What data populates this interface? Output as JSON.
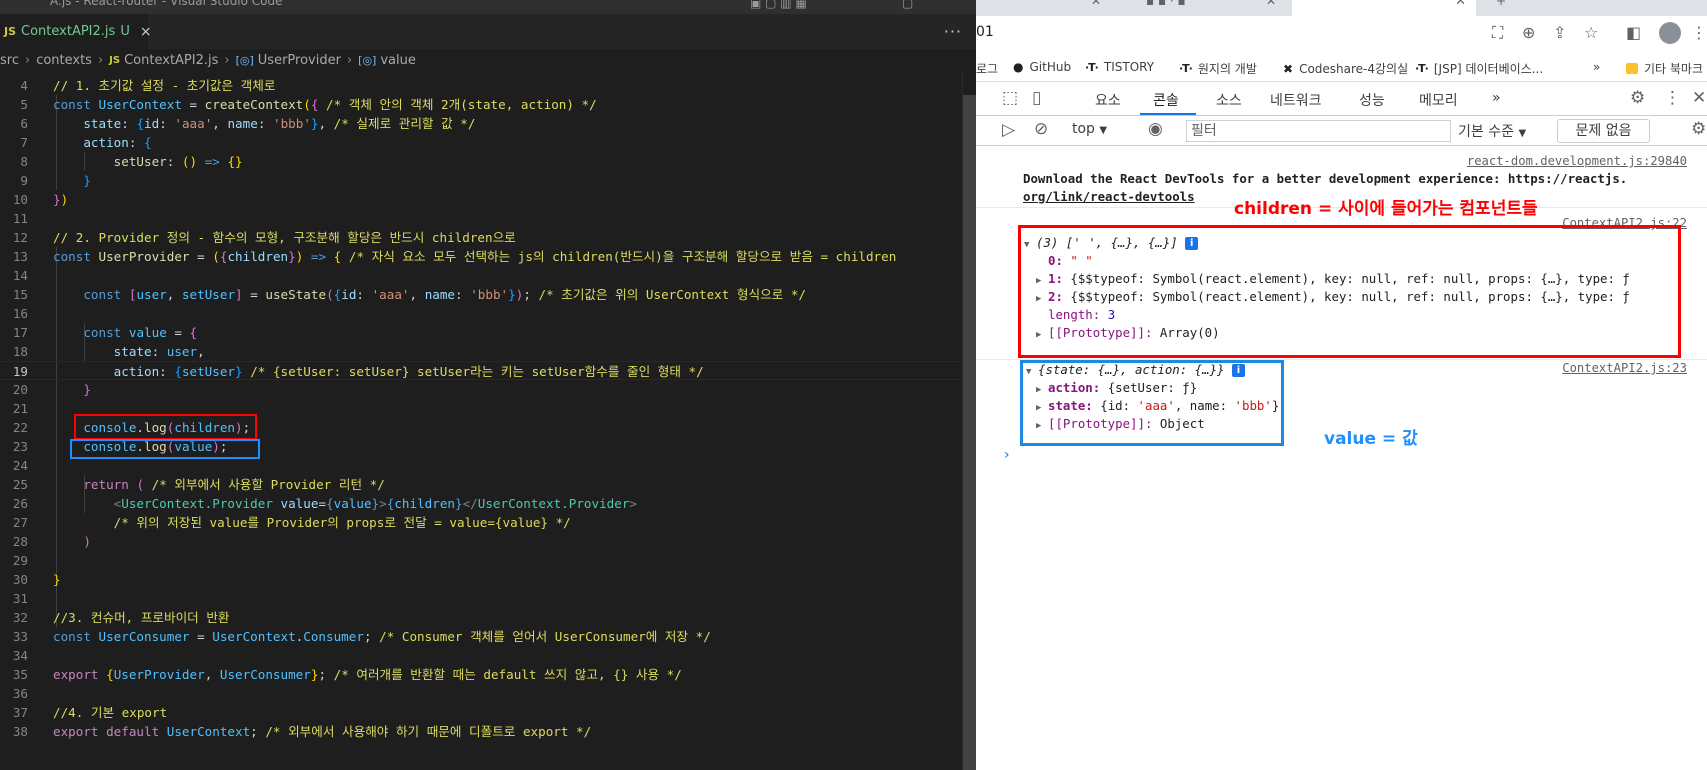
{
  "vscode": {
    "window_title": "A.js - React-router - Visual Studio Code",
    "tab": {
      "icon": "JS",
      "filename": "ContextAPI2.js",
      "status": "U",
      "close": "×"
    },
    "more_actions": "···",
    "breadcrumb": {
      "items": [
        "src",
        "contexts",
        "ContextAPI2.js",
        "UserProvider",
        "value"
      ],
      "js_icon": "JS",
      "symbol_icon": "[◎]"
    },
    "editor": {
      "line_numbers": [
        "4",
        "5",
        "6",
        "7",
        "8",
        "9",
        "10",
        "11",
        "12",
        "13",
        "14",
        "15",
        "16",
        "17",
        "18",
        "19",
        "20",
        "21",
        "22",
        "23",
        "24",
        "25",
        "26",
        "27",
        "28",
        "29",
        "30",
        "31",
        "32",
        "33",
        "34",
        "35",
        "36",
        "37",
        "38"
      ],
      "active_line": "19"
    }
  },
  "chrome": {
    "url_fragment": "01",
    "bookmarks": [
      {
        "label": "로그",
        "icon": ""
      },
      {
        "label": "GitHub",
        "icon": "github-icon"
      },
      {
        "label": "TISTORY",
        "icon": "tistory-icon"
      },
      {
        "label": "원지의 개발",
        "icon": "tistory-icon"
      },
      {
        "label": "Codeshare-4강의실",
        "icon": "codeshare-icon"
      },
      {
        "label": "[JSP] 데이터베이스...",
        "icon": "tistory-icon"
      },
      {
        "label": "»",
        "icon": ""
      },
      {
        "label": "기타 북마크",
        "icon": "folder-icon"
      }
    ],
    "devtools": {
      "tabs": [
        "요소",
        "콘솔",
        "소스",
        "네트워크",
        "성능",
        "메모리",
        "»"
      ],
      "active_tab": "콘솔",
      "toolbar": {
        "context": "top",
        "filter_placeholder": "필터",
        "level": "기본 수준",
        "issues": "문제 없음"
      },
      "console": {
        "devtools_src": "react-dom.development.js:29840",
        "devtools_msg_1": "Download the React DevTools for a better development experience: https://reactjs.",
        "devtools_msg_2": "org/link/react-devtools",
        "log1_src": "ContextAPI2.js:22",
        "log1_summary": "(3) [' ', {…}, {…}]",
        "log1_rows": {
          "r0_key": "0:",
          "r0_val": "\" \"",
          "r1_key": "1:",
          "r1_val": "{$$typeof: Symbol(react.element), key: null, ref: null, props: {…}, type: ƒ",
          "r2_key": "2:",
          "r2_val": "{$$typeof: Symbol(react.element), key: null, ref: null, props: {…}, type: ƒ",
          "length_key": "length:",
          "length_val": "3",
          "proto_key": "[[Prototype]]:",
          "proto_val": "Array(0)"
        },
        "log2_src": "ContextAPI2.js:23",
        "log2_summary": "{state: {…}, action: {…}}",
        "log2_rows": {
          "action_key": "action:",
          "action_val": "{setUser: ƒ}",
          "state_key": "state:",
          "state_val_a": "{id: ",
          "state_val_b": "'aaa'",
          "state_val_c": ", name: ",
          "state_val_d": "'bbb'",
          "state_val_e": "}",
          "proto_key": "[[Prototype]]:",
          "proto_val": "Object"
        },
        "prompt": "›"
      }
    },
    "annotations": {
      "red_text": "children = 사이에 들어가는 컴포넌트들",
      "blue_text": "value = 값"
    }
  },
  "colors": {
    "annotation_red": "#ff0000",
    "annotation_blue": "#1e90ff",
    "devtools_active_tab": "#1a73e8"
  }
}
